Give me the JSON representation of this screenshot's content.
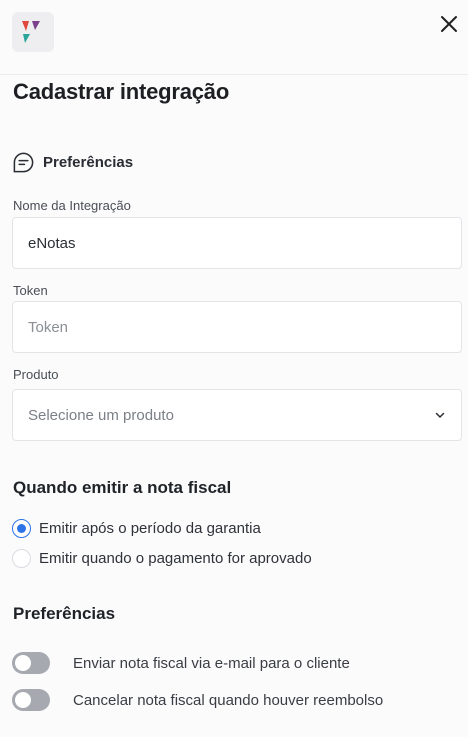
{
  "header": {
    "logo_icon": "brand-flag-logo-icon",
    "close_icon": "close-icon"
  },
  "title": "Cadastrar integração",
  "section": {
    "icon": "chat-bubble-lines-icon",
    "label": "Preferências"
  },
  "fields": {
    "name": {
      "label": "Nome da Integração",
      "value": "eNotas"
    },
    "token": {
      "label": "Token",
      "value": "",
      "placeholder": "Token"
    },
    "product": {
      "label": "Produto",
      "placeholder": "Selecione um produto"
    }
  },
  "emission": {
    "heading": "Quando emitir a nota fiscal",
    "options": [
      {
        "label": "Emitir após o período da garantia",
        "checked": true
      },
      {
        "label": "Emitir quando o pagamento for aprovado",
        "checked": false
      }
    ]
  },
  "preferences": {
    "heading": "Preferências",
    "toggles": [
      {
        "label": "Enviar nota fiscal via e-mail para o cliente",
        "on": false
      },
      {
        "label": "Cancelar nota fiscal quando houver reembolso",
        "on": false
      }
    ]
  },
  "colors": {
    "accent": "#2c73e8",
    "toggle_off": "#a6aab0",
    "logo_red": "#e0483e",
    "logo_purple": "#7b3f8c",
    "logo_teal": "#2aa59a"
  }
}
